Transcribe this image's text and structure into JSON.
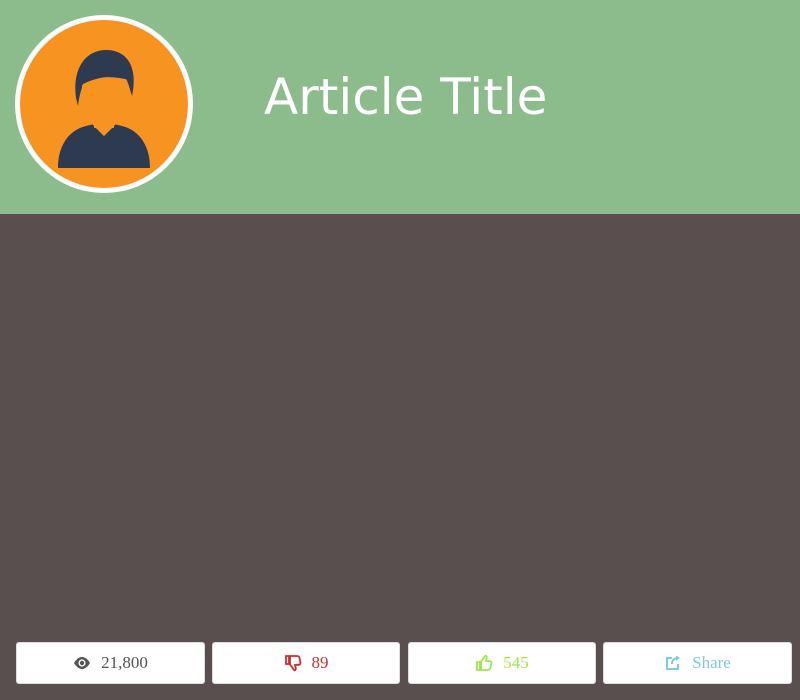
{
  "article": {
    "title": "Article Title"
  },
  "stats": {
    "views": "21,800",
    "dislikes": "89",
    "likes": "545",
    "share_label": "Share"
  },
  "colors": {
    "header_bg": "#8cbc8c",
    "content_bg": "#594f4f",
    "avatar_bg": "#f79421",
    "avatar_figure": "#2e3a4f",
    "views_color": "#555555",
    "dislikes_color": "#c9302c",
    "likes_color": "#9ce64a",
    "share_color": "#7ec8e3"
  },
  "icons": {
    "views": "eye-icon",
    "dislikes": "thumbs-down-icon",
    "likes": "thumbs-up-icon",
    "share": "share-icon",
    "avatar": "user-icon"
  }
}
